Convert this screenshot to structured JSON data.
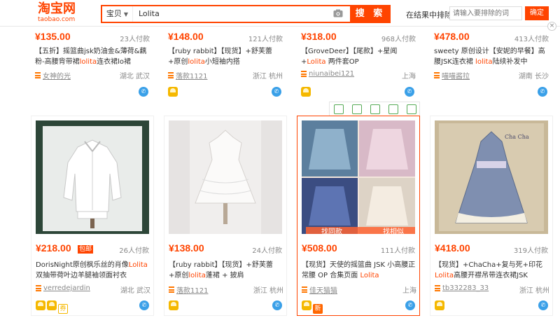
{
  "header": {
    "logo_cn": "淘宝网",
    "logo_en": "taobao.com",
    "search_category": "宝贝",
    "search_value": "Lolita",
    "search_button": "搜 索",
    "exclude_label": "在结果中排除",
    "exclude_placeholder": "请输入要排除的词",
    "exclude_button": "确定",
    "close_symbol": "×"
  },
  "colors": {
    "accent": "#ff4400",
    "tmall_gold": "#f5b800",
    "wangwang": "#3aa0e8"
  },
  "top_row": [
    {
      "price": "¥135.00",
      "sales": "23人付款",
      "title_pre": "【五折】摇篮曲jsk奶油金&薄荷&藕粉-高腰背带裙",
      "kw": "lolita",
      "title_post": "连衣裙lo裙",
      "shop": "女神的光",
      "location": "湖北 武汉"
    },
    {
      "price": "¥148.00",
      "sales": "121人付款",
      "title_pre": "【ruby rabbit】【现货】+舒芙蕾+原创",
      "kw": "lolita",
      "title_post": "小短袖内搭",
      "shop": "落款1121",
      "location": "浙江 杭州"
    },
    {
      "price": "¥318.00",
      "sales": "968人付款",
      "title_pre": "【GroveDeer】【尾款】+星闻+",
      "kw": "Lolita",
      "title_post": " 两件套OP",
      "shop": "niunaibei121",
      "location": "上海"
    },
    {
      "price": "¥478.00",
      "sales": "413人付款",
      "title_pre": "sweety 原创设计【安妮的早餐】高腰JSK连衣裙 ",
      "kw": "lolita",
      "title_post": "陆续补发中",
      "shop": "喵喵酱拉",
      "location": "湖南 长沙"
    }
  ],
  "bottom_row": [
    {
      "price": "¥218.00",
      "badge": "包邮",
      "sales": "26人付款",
      "title_pre": "DorisNight原创枫乐丝的肖像",
      "kw": "Lolita",
      "title_post": "双抽带荷叶边羊腿袖领面衬衣",
      "shop": "verredejardin",
      "location": "湖北 武汉",
      "icons": [
        "gold",
        "gold",
        "ticket"
      ]
    },
    {
      "price": "¥138.00",
      "sales": "24人付款",
      "title_pre": "【ruby rabbit】【现货】+舒芙蕾+原创",
      "kw": "lolita",
      "title_post": "蓬裙 + 披肩",
      "shop": "落款1121",
      "location": "浙江 杭州",
      "icons": [
        "gold"
      ]
    },
    {
      "price": "¥508.00",
      "sales": "111人付款",
      "title_pre": "【现货】天使的摇篮曲 JSK 小高腰正常腰 OP 合集页面 ",
      "kw": "Lolita",
      "title_post": "",
      "shop": "佳天猫猫",
      "location": "上海",
      "icons": [
        "gold",
        "xin"
      ],
      "dual_left": "找同款",
      "dual_right": "找相似"
    },
    {
      "price": "¥418.00",
      "sales": "319人付款",
      "title_pre": "【现货】+ChaCha+复与死+印花",
      "kw": "Lolita",
      "title_post": "高腰开襟吊带连衣裙JSK",
      "shop": "tb332283_33",
      "location": "浙江 杭州",
      "icons": [
        "gold"
      ],
      "image_text": "Cha Cha"
    }
  ],
  "icon_names": [
    "camera-icon",
    "shop-icon",
    "wangwang-icon",
    "tmall-gold-icon",
    "new-badge-icon",
    "coupon-icon"
  ]
}
